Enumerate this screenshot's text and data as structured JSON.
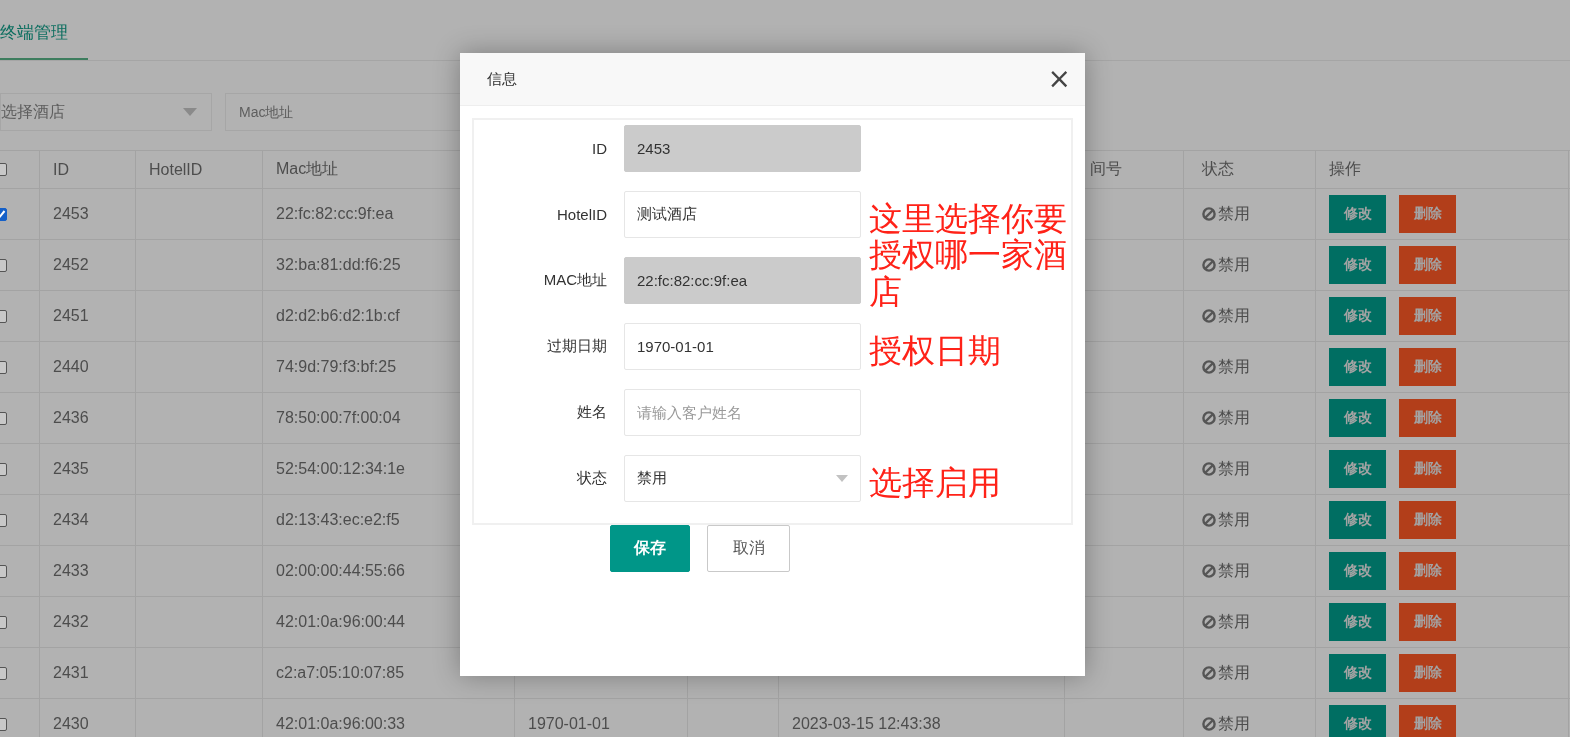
{
  "tab": {
    "label": "终端管理",
    "selected": true
  },
  "filters": {
    "hotel_select": {
      "placeholder": "选择酒店"
    },
    "mac_field": {
      "placeholder": "Mac地址"
    }
  },
  "table": {
    "all_checked": false,
    "header": {
      "id": "ID",
      "hotel_id": "HotelID",
      "mac": "Mac地址",
      "column_8": "间号",
      "status": "状态",
      "actions": "操作"
    },
    "rows": [
      {
        "selected": true,
        "id": "2453",
        "mac": "22:fc:82:cc:9f:ea",
        "status": "禁用",
        "edit": "修改",
        "delete": "删除"
      },
      {
        "selected": false,
        "id": "2452",
        "mac": "32:ba:81:dd:f6:25",
        "status": "禁用",
        "edit": "修改",
        "delete": "删除"
      },
      {
        "selected": false,
        "id": "2451",
        "mac": "d2:d2:b6:d2:1b:cf",
        "status": "禁用",
        "edit": "修改",
        "delete": "删除"
      },
      {
        "selected": false,
        "id": "2440",
        "mac": "74:9d:79:f3:bf:25",
        "status": "禁用",
        "edit": "修改",
        "delete": "删除"
      },
      {
        "selected": false,
        "id": "2436",
        "mac": "78:50:00:7f:00:04",
        "status": "禁用",
        "edit": "修改",
        "delete": "删除"
      },
      {
        "selected": false,
        "id": "2435",
        "mac": "52:54:00:12:34:1e",
        "status": "禁用",
        "edit": "修改",
        "delete": "删除"
      },
      {
        "selected": false,
        "id": "2434",
        "mac": "d2:13:43:ec:e2:f5",
        "status": "禁用",
        "edit": "修改",
        "delete": "删除"
      },
      {
        "selected": false,
        "id": "2433",
        "mac": "02:00:00:44:55:66",
        "status": "禁用",
        "edit": "修改",
        "delete": "删除"
      },
      {
        "selected": false,
        "id": "2432",
        "mac": "42:01:0a:96:00:44",
        "status": "禁用",
        "edit": "修改",
        "delete": "删除"
      },
      {
        "selected": false,
        "id": "2431",
        "mac": "c2:a7:05:10:07:85",
        "status": "禁用",
        "edit": "修改",
        "delete": "删除"
      },
      {
        "selected": false,
        "id": "2430",
        "mac": "42:01:0a:96:00:33",
        "column_5": "1970-01-01",
        "column_7": "2023-03-15 12:43:38",
        "status": "禁用",
        "edit": "修改",
        "delete": "删除"
      }
    ]
  },
  "dialog": {
    "title": "信息",
    "close": "×",
    "fields": [
      {
        "kind": "input",
        "label": "ID",
        "value": "2453",
        "disabled": true
      },
      {
        "kind": "input",
        "label": "HotelID",
        "value": "测试酒店",
        "disabled": false,
        "note": "这里选择你要授权哪一家酒店"
      },
      {
        "kind": "input",
        "label": "MAC地址",
        "value": "22:fc:82:cc:9f:ea",
        "disabled": true
      },
      {
        "kind": "input",
        "label": "过期日期",
        "value": "1970-01-01",
        "disabled": false,
        "note": "授权日期"
      },
      {
        "kind": "input",
        "label": "姓名",
        "placeholder": "请输入客户姓名",
        "disabled": false
      },
      {
        "kind": "select",
        "label": "状态",
        "value": "禁用",
        "note": "选择启用"
      }
    ],
    "buttons": [
      {
        "kind": "primary",
        "label": "保存"
      },
      {
        "kind": "default",
        "label": "取消"
      }
    ]
  }
}
